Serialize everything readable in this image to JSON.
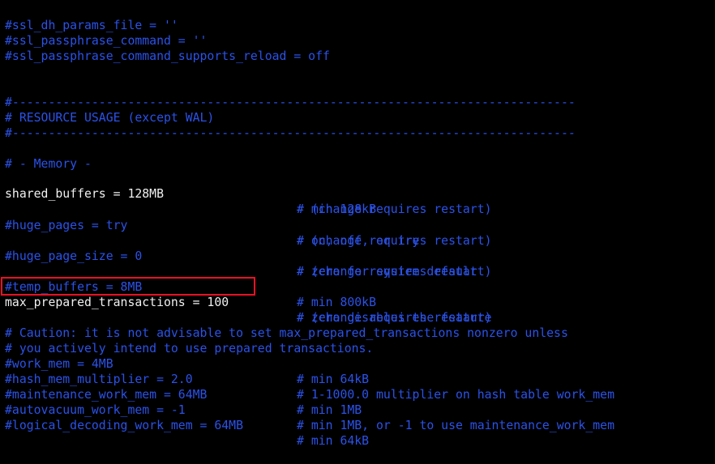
{
  "colors": {
    "background": "#000000",
    "comment_text": "#2b52e8",
    "active_text": "#f0f0f0",
    "highlight_border": "#e81123"
  },
  "lines": [
    {
      "code": "#ssl_dh_params_file = ''",
      "comment": ""
    },
    {
      "code": "#ssl_passphrase_command = ''",
      "comment": ""
    },
    {
      "code": "#ssl_passphrase_command_supports_reload = off",
      "comment": ""
    },
    {
      "code": "#------------------------------------------------------------------------------",
      "comment": ""
    },
    {
      "code": "# RESOURCE USAGE (except WAL)",
      "comment": ""
    },
    {
      "code": "#------------------------------------------------------------------------------",
      "comment": ""
    },
    {
      "code": "# - Memory -",
      "comment": ""
    },
    {
      "code": "shared_buffers = 128MB",
      "comment": "# min 128kB"
    },
    {
      "code": "",
      "comment": "# (change requires restart)"
    },
    {
      "code": "#huge_pages = try",
      "comment": "# on, off, or try"
    },
    {
      "code": "",
      "comment": "# (change requires restart)"
    },
    {
      "code": "#huge_page_size = 0",
      "comment": "# zero for system default"
    },
    {
      "code": "",
      "comment": "# (change requires restart)"
    },
    {
      "code": "#temp_buffers = 8MB",
      "comment": "# min 800kB"
    },
    {
      "code": "max_prepared_transactions = 100",
      "comment": "# zero disables the feature"
    },
    {
      "code": "",
      "comment": "# (change requires restart)"
    },
    {
      "code": "# Caution: it is not advisable to set max_prepared_transactions nonzero unless",
      "comment": ""
    },
    {
      "code": "# you actively intend to use prepared transactions.",
      "comment": ""
    },
    {
      "code": "#work_mem = 4MB",
      "comment": "# min 64kB"
    },
    {
      "code": "#hash_mem_multiplier = 2.0",
      "comment": "# 1-1000.0 multiplier on hash table work_mem"
    },
    {
      "code": "#maintenance_work_mem = 64MB",
      "comment": "# min 1MB"
    },
    {
      "code": "#autovacuum_work_mem = -1",
      "comment": "# min 1MB, or -1 to use maintenance_work_mem"
    },
    {
      "code": "#logical_decoding_work_mem = 64MB",
      "comment": "# min 64kB"
    }
  ]
}
